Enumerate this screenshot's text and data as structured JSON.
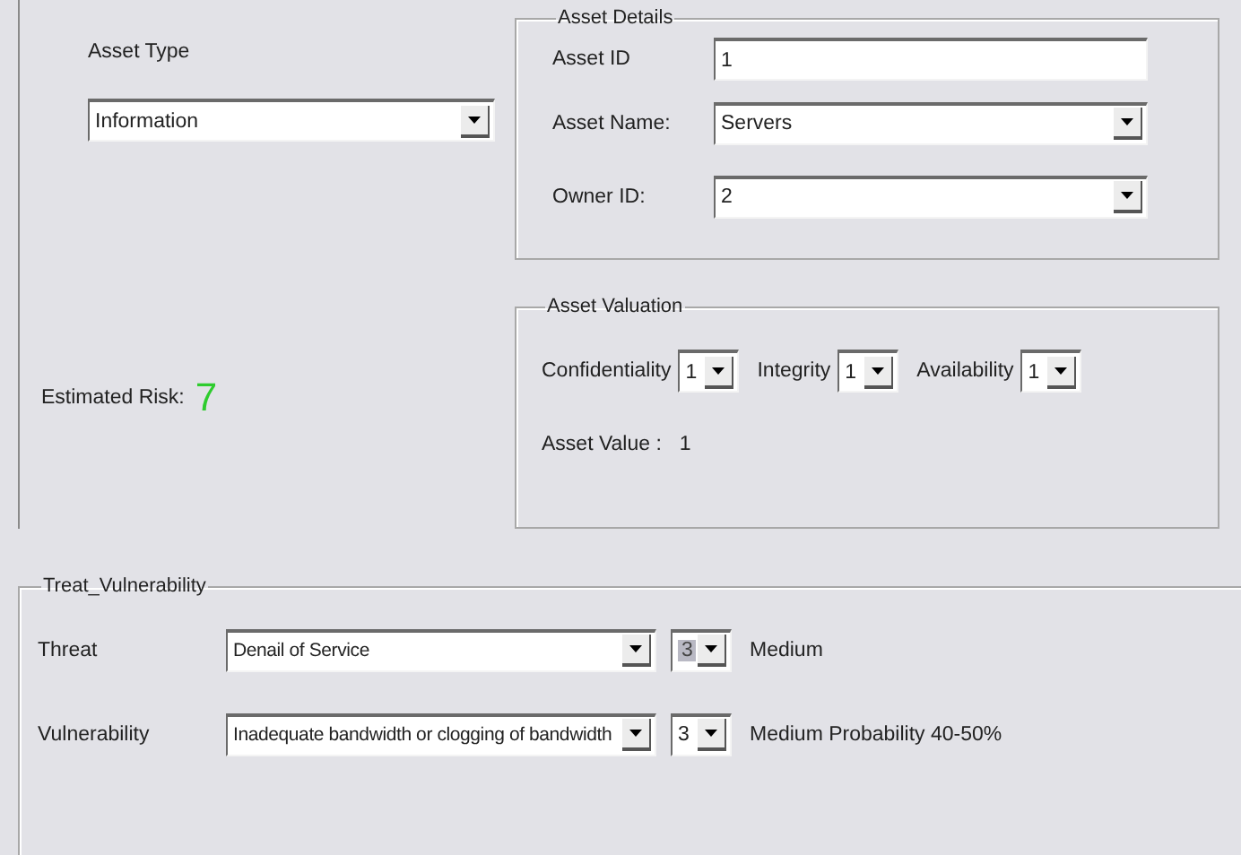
{
  "asset_type": {
    "label": "Asset Type",
    "value": "Information"
  },
  "asset_details": {
    "title": "Asset Details",
    "fields": [
      {
        "kind": "text",
        "label": "Asset ID",
        "value": "1"
      },
      {
        "kind": "dropdown",
        "label": "Asset Name:",
        "value": "Servers"
      },
      {
        "kind": "dropdown",
        "label": "Owner ID:",
        "value": "2"
      }
    ]
  },
  "estimated_risk": {
    "label": "Estimated Risk:",
    "value": "7"
  },
  "asset_valuation": {
    "title": "Asset Valuation",
    "ratings": [
      {
        "label": "Confidentiality",
        "value": "1"
      },
      {
        "label": "Integrity",
        "value": "1"
      },
      {
        "label": "Availability",
        "value": "1"
      }
    ],
    "asset_value": {
      "label": "Asset Value :",
      "value": "1"
    }
  },
  "threat_vulnerability": {
    "title": "Treat_Vulnerability",
    "rows": [
      {
        "label": "Threat",
        "value": "Denail of Service",
        "score": "3",
        "highlighted": true,
        "description": "Medium"
      },
      {
        "label": "Vulnerability",
        "value": "Inadequate bandwidth or clogging of bandwidth",
        "score": "3",
        "highlighted": false,
        "description": "Medium Probability 40-50%"
      }
    ]
  }
}
